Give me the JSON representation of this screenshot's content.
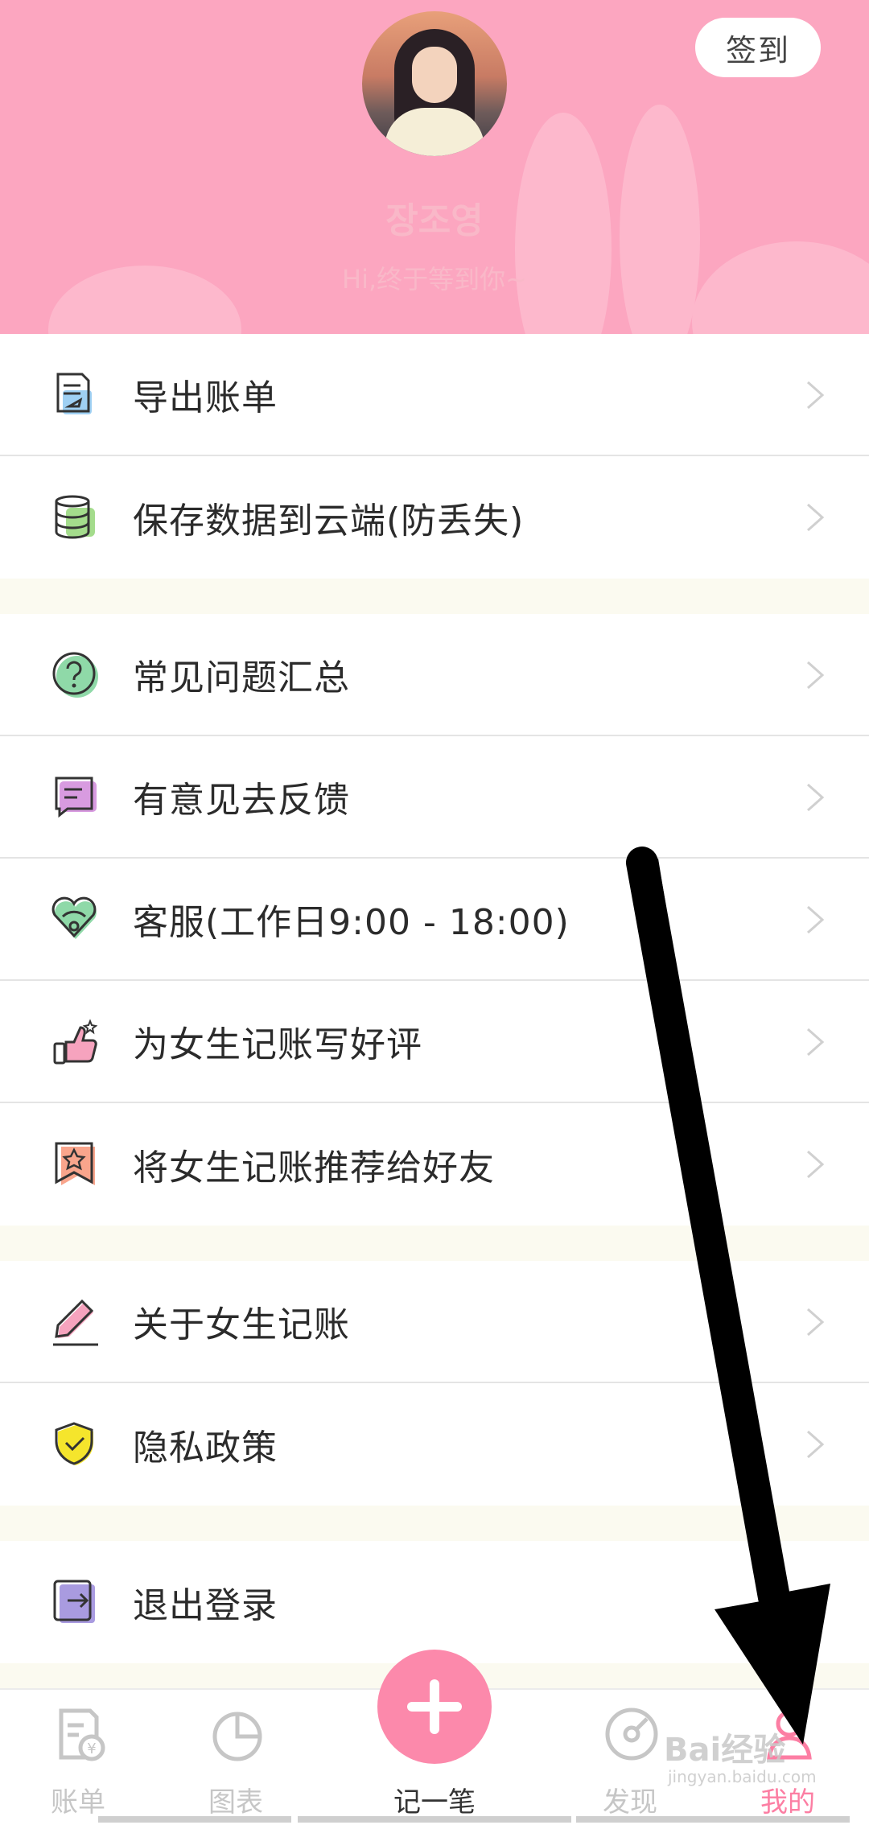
{
  "header": {
    "signin_label": "签到",
    "username": "장조영",
    "greeting": "Hi,终于等到你~"
  },
  "menu": {
    "group1": [
      {
        "label": "导出账单",
        "icon": "export-bill-icon"
      },
      {
        "label": "保存数据到云端(防丢失)",
        "icon": "cloud-database-icon"
      }
    ],
    "group2": [
      {
        "label": "常见问题汇总",
        "icon": "question-icon"
      },
      {
        "label": "有意见去反馈",
        "icon": "feedback-message-icon"
      },
      {
        "label": "客服(工作日9:00 - 18:00)",
        "icon": "customer-service-heart-icon"
      },
      {
        "label": "为女生记账写好评",
        "icon": "thumbs-up-icon"
      },
      {
        "label": "将女生记账推荐给好友",
        "icon": "star-bookmark-icon"
      }
    ],
    "group3": [
      {
        "label": "关于女生记账",
        "icon": "pencil-icon"
      },
      {
        "label": "隐私政策",
        "icon": "shield-check-icon"
      }
    ],
    "group4": [
      {
        "label": "退出登录",
        "icon": "logout-icon"
      }
    ]
  },
  "tabbar": {
    "tabs": [
      {
        "label": "账单",
        "icon": "bill-icon",
        "active": false
      },
      {
        "label": "图表",
        "icon": "pie-chart-icon",
        "active": false
      },
      {
        "label": "记一笔",
        "icon": "plus-icon",
        "active": false
      },
      {
        "label": "发现",
        "icon": "discover-icon",
        "active": false
      },
      {
        "label": "我的",
        "icon": "profile-icon",
        "active": true
      }
    ]
  },
  "watermark": {
    "text": "Bai经验",
    "sub": "jingyan.baidu.com"
  },
  "colors": {
    "header_bg": "#fca6c0",
    "accent": "#fc89ab",
    "active_tab": "#fc7ea3",
    "page_bg": "#fbfaf0"
  }
}
